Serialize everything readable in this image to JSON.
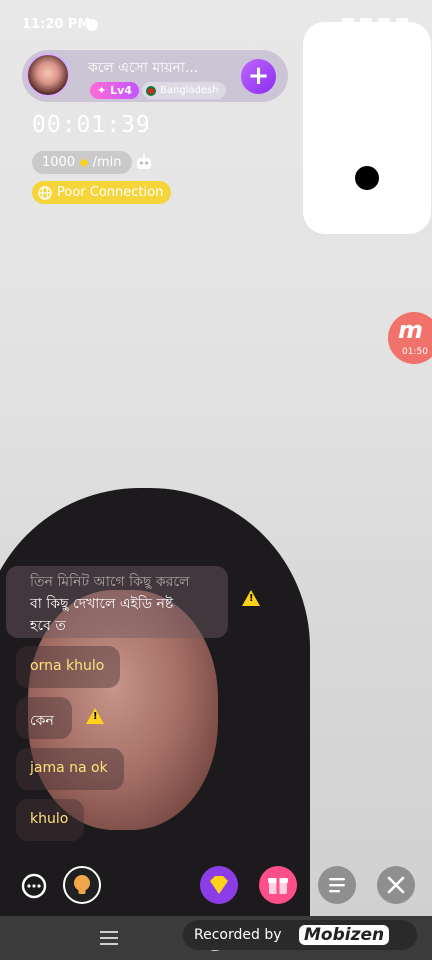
{
  "status_bar": {
    "time": "11:20 PM"
  },
  "host": {
    "name": "কলে এসো মায়না...",
    "level": "Lv4",
    "country": "Bangladesh",
    "follow_icon": "plus-icon"
  },
  "call": {
    "timer": "00:01:39",
    "rate": "1000",
    "rate_unit": "/min",
    "connection_status": "Poor Connection"
  },
  "mobizen_overlay": {
    "time": "01:50",
    "logo_letter": "m"
  },
  "chat": {
    "messages": [
      {
        "line1": "তিন মিনিট আগে কিছু করলে",
        "line2": "বা কিছু দেখালে এইডি নষ্ট",
        "line3": "হবে ত"
      },
      {
        "text": "orna khulo"
      },
      {
        "text": "কেন"
      },
      {
        "text": "jama na ok"
      },
      {
        "text": "khulo"
      }
    ]
  },
  "bottom_bar": {
    "icons": [
      "chat-bubble-icon",
      "lightbulb-icon",
      "diamond-icon",
      "gift-icon",
      "menu-icon",
      "close-icon"
    ]
  },
  "recording_banner": {
    "label": "Recorded by",
    "brand": "Mobizen"
  },
  "colors": {
    "accent_purple": "#9a3df2",
    "connection_yellow": "#f5d53a",
    "warning_yellow": "#ffd21a"
  }
}
